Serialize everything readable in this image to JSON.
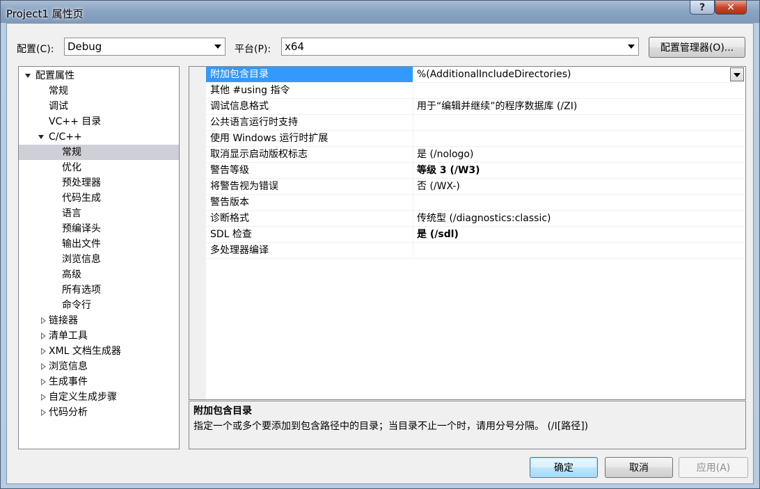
{
  "window": {
    "title": "Project1 属性页",
    "help_label": "?",
    "close_label": "✕"
  },
  "toolbar": {
    "config_label": "配置(C):",
    "config_value": "Debug",
    "platform_label": "平台(P):",
    "platform_value": "x64",
    "config_manager_label": "配置管理器(O)..."
  },
  "tree": {
    "items": [
      {
        "label": "配置属性",
        "expander": "open"
      },
      {
        "label": "常规"
      },
      {
        "label": "调试"
      },
      {
        "label": "VC++ 目录"
      },
      {
        "label": "C/C++",
        "expander": "open"
      },
      {
        "label": "常规",
        "selected": true
      },
      {
        "label": "优化"
      },
      {
        "label": "预处理器"
      },
      {
        "label": "代码生成"
      },
      {
        "label": "语言"
      },
      {
        "label": "预编译头"
      },
      {
        "label": "输出文件"
      },
      {
        "label": "浏览信息"
      },
      {
        "label": "高级"
      },
      {
        "label": "所有选项"
      },
      {
        "label": "命令行"
      },
      {
        "label": "链接器",
        "expander": "closed"
      },
      {
        "label": "清单工具",
        "expander": "closed"
      },
      {
        "label": "XML 文档生成器",
        "expander": "closed"
      },
      {
        "label": "浏览信息",
        "expander": "closed"
      },
      {
        "label": "生成事件",
        "expander": "closed"
      },
      {
        "label": "自定义生成步骤",
        "expander": "closed"
      },
      {
        "label": "代码分析",
        "expander": "closed"
      }
    ]
  },
  "properties": [
    {
      "name": "附加包含目录",
      "value": "%(AdditionalIncludeDirectories)",
      "selected": true
    },
    {
      "name": "其他 #using 指令",
      "value": ""
    },
    {
      "name": "调试信息格式",
      "value": "用于“编辑并继续”的程序数据库 (/ZI)"
    },
    {
      "name": "公共语言运行时支持",
      "value": ""
    },
    {
      "name": "使用 Windows 运行时扩展",
      "value": ""
    },
    {
      "name": "取消显示启动版权标志",
      "value": "是 (/nologo)"
    },
    {
      "name": "警告等级",
      "value": "等级 3 (/W3)",
      "bold": true
    },
    {
      "name": "将警告视为错误",
      "value": "否 (/WX-)"
    },
    {
      "name": "警告版本",
      "value": ""
    },
    {
      "name": "诊断格式",
      "value": "传统型 (/diagnostics:classic)"
    },
    {
      "name": "SDL 检查",
      "value": "是 (/sdl)",
      "bold": true
    },
    {
      "name": "多处理器编译",
      "value": ""
    }
  ],
  "description": {
    "title": "附加包含目录",
    "text": "指定一个或多个要添加到包含路径中的目录；当目录不止一个时，请用分号分隔。    (/I[路径])"
  },
  "buttons": {
    "ok": "确定",
    "cancel": "取消",
    "apply": "应用(A)"
  },
  "colors": {
    "selection": "#3399ff",
    "tree_selection": "#cfcfd7"
  }
}
